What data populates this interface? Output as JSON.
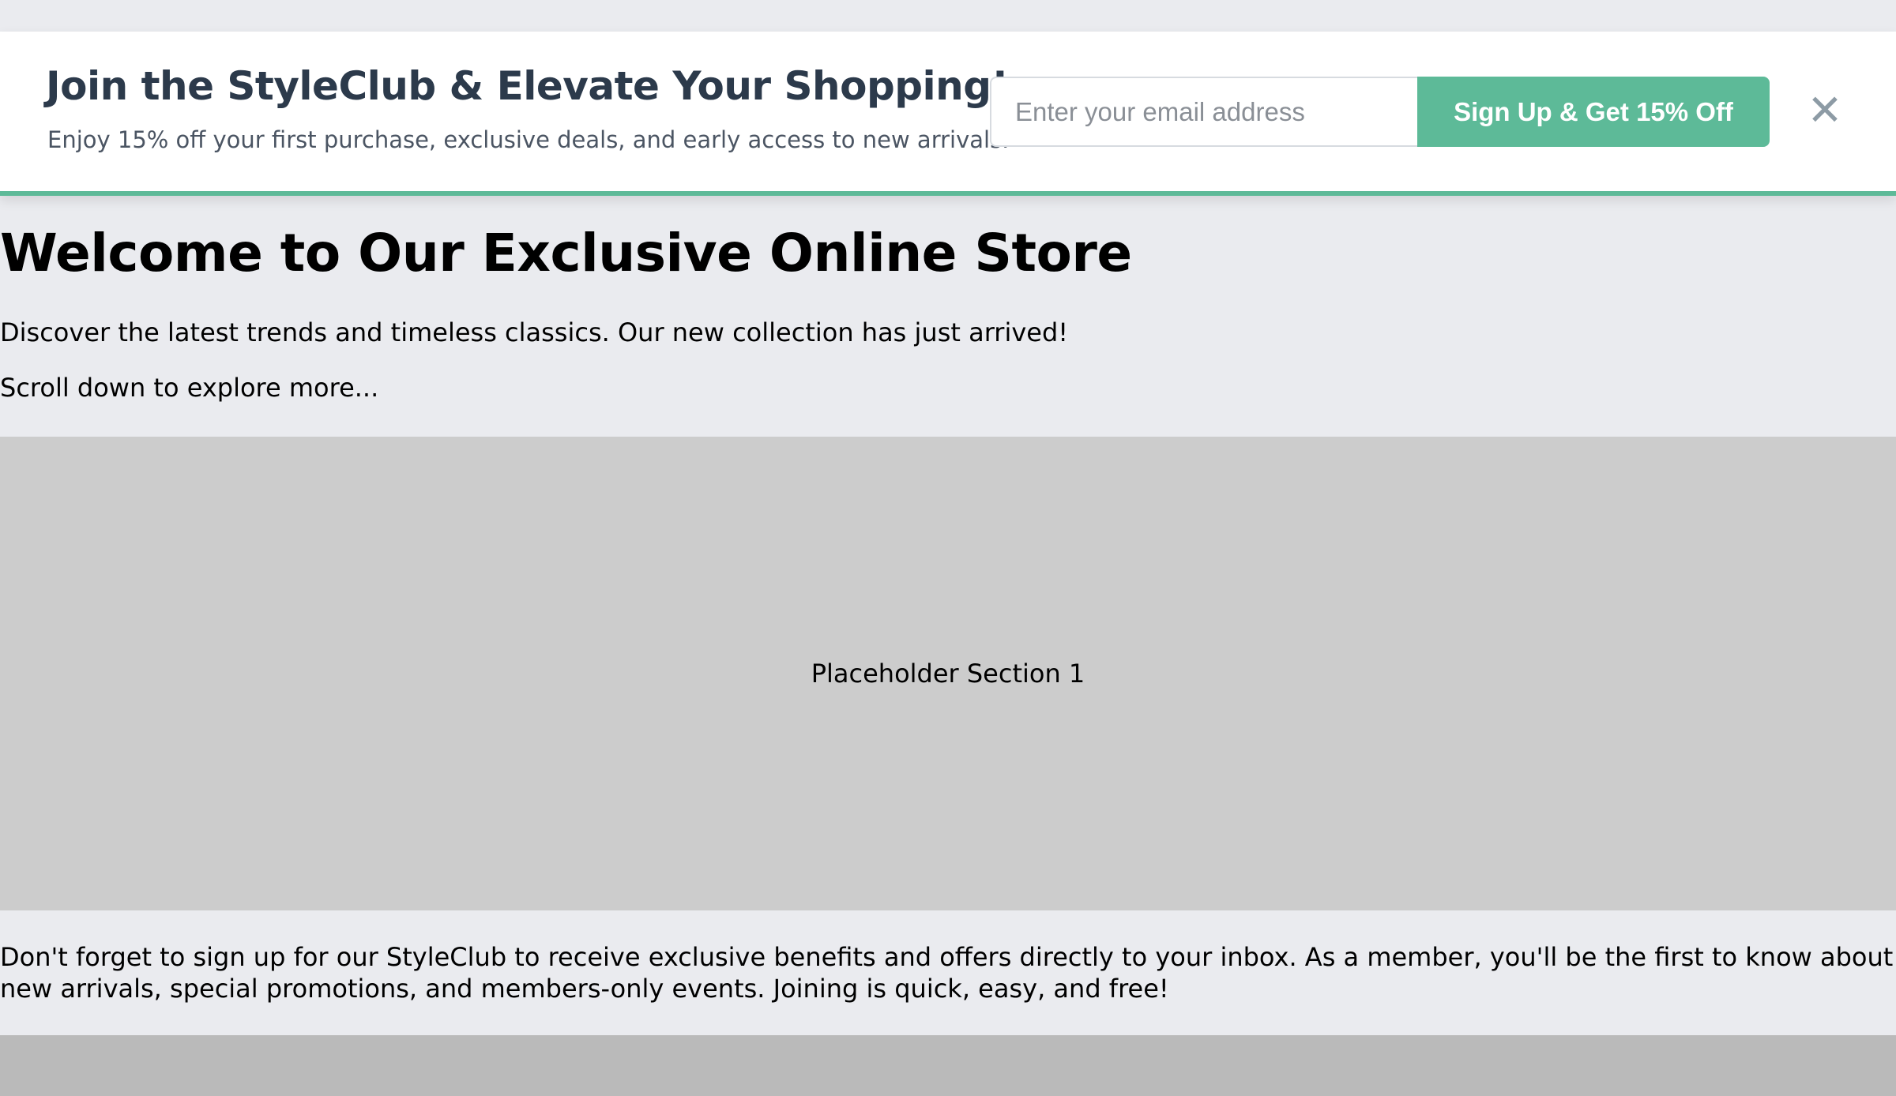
{
  "banner": {
    "title": "Join the StyleClub & Elevate Your Shopping!",
    "subtitle": "Enjoy 15% off your first purchase, exclusive deals, and early access to new arrivals.",
    "email_placeholder": "Enter your email address",
    "signup_label": "Sign Up & Get 15% Off",
    "close_glyph": "✕",
    "close_icon": "close-icon",
    "accent_color": "#5dba98"
  },
  "main": {
    "title": "Welcome to Our Exclusive Online Store",
    "intro": "Discover the latest trends and timeless classics. Our new collection has just arrived!",
    "scroll_hint": "Scroll down to explore more...",
    "placeholder_1_label": "Placeholder Section 1",
    "reminder": "Don't forget to sign up for our StyleClub to receive exclusive benefits and offers directly to your inbox. As a member, you'll be the first to know about new arrivals, special promotions, and members-only events. Joining is quick, easy, and free!"
  }
}
